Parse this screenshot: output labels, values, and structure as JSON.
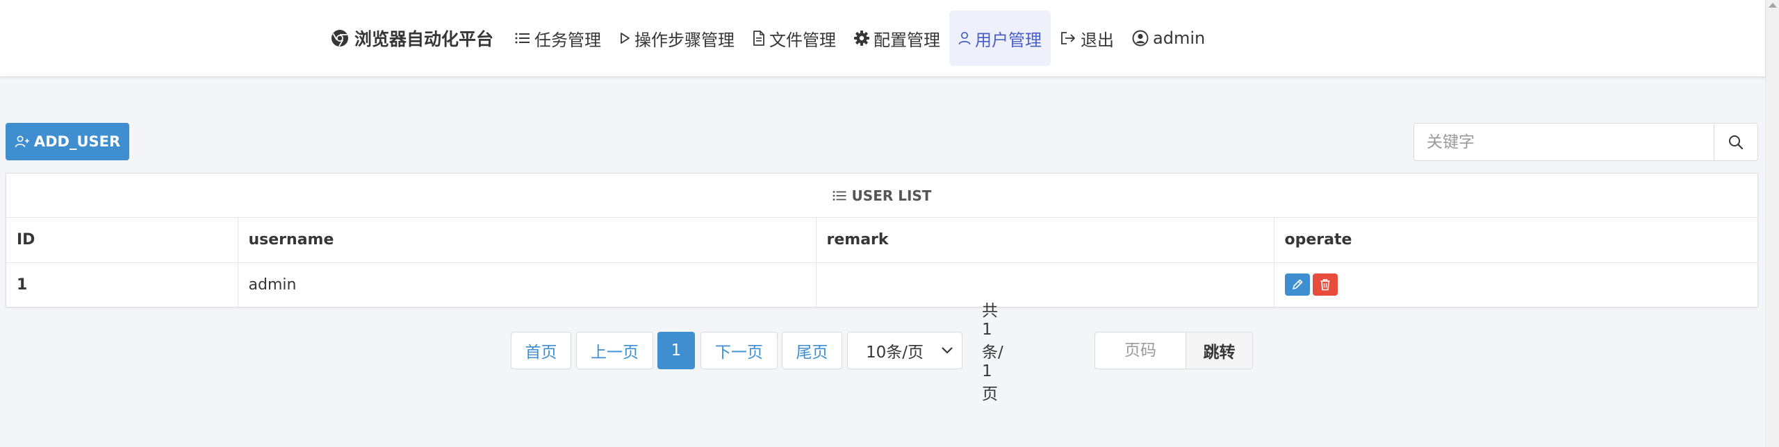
{
  "navbar": {
    "brand": "浏览器自动化平台",
    "items": [
      {
        "label": "任务管理",
        "icon": "list-icon"
      },
      {
        "label": "操作步骤管理",
        "icon": "play-icon"
      },
      {
        "label": "文件管理",
        "icon": "file-icon"
      },
      {
        "label": "配置管理",
        "icon": "gear-icon"
      },
      {
        "label": "用户管理",
        "icon": "user-icon",
        "active": true
      },
      {
        "label": "退出",
        "icon": "logout-icon"
      },
      {
        "label": "admin",
        "icon": "user-circle-icon"
      }
    ],
    "active_color": "#485fc7"
  },
  "toolbar": {
    "add_label": "ADD_USER",
    "search_placeholder": "关键字"
  },
  "table": {
    "title": "USER LIST",
    "columns": [
      "ID",
      "username",
      "remark",
      "operate"
    ],
    "rows": [
      {
        "id": "1",
        "username": "admin",
        "remark": ""
      }
    ]
  },
  "pagination": {
    "first": "首页",
    "prev": "上一页",
    "current": "1",
    "next": "下一页",
    "last": "尾页",
    "page_size": "10条/页",
    "total": "共 1 条/ 1 页",
    "page_input_placeholder": "页码",
    "go": "跳转"
  },
  "colors": {
    "primary": "#3e8ed0",
    "danger": "#e74c3c",
    "background": "#f4f5f9"
  }
}
